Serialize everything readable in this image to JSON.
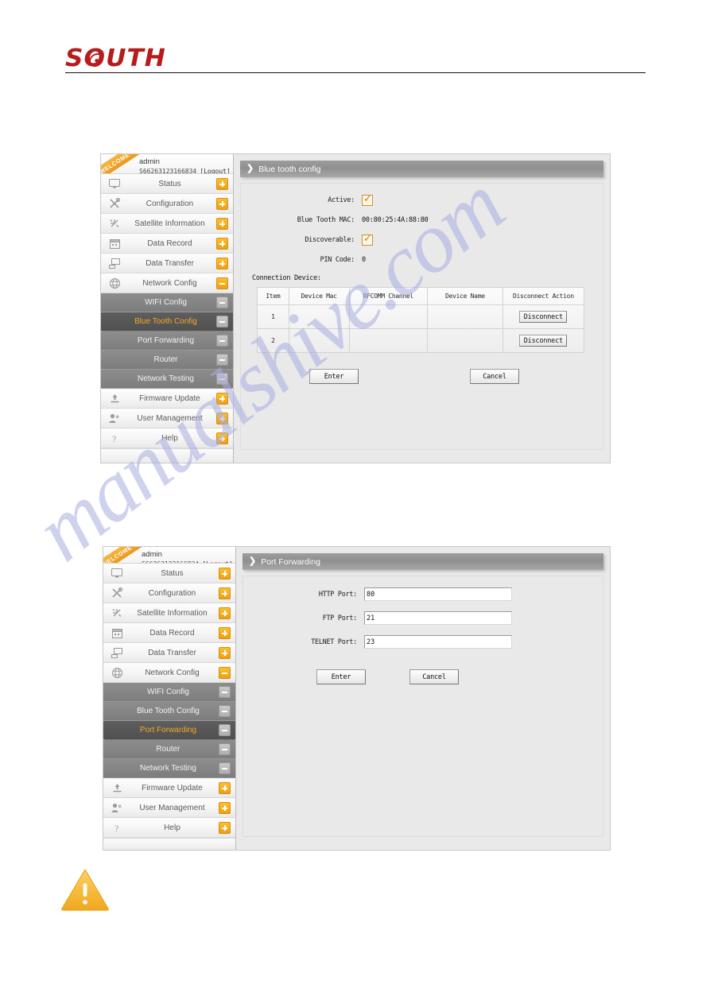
{
  "document": {
    "brand": "SOUTH",
    "watermark": "manualshive.com"
  },
  "sidebar": {
    "welcome_ribbon": "WELCOME",
    "username": "admin",
    "serial": "S66263123166834",
    "logout": "[Logout]",
    "items": [
      {
        "label": "Status",
        "icon": "monitor-icon",
        "toggle": "plus"
      },
      {
        "label": "Configuration",
        "icon": "tools-icon",
        "toggle": "plus"
      },
      {
        "label": "Satellite Information",
        "icon": "satellite-icon",
        "toggle": "plus"
      },
      {
        "label": "Data Record",
        "icon": "calendar-icon",
        "toggle": "plus"
      },
      {
        "label": "Data Transfer",
        "icon": "transfer-icon",
        "toggle": "plus"
      },
      {
        "label": "Network Config",
        "icon": "globe-icon",
        "toggle": "open"
      }
    ],
    "submenu": [
      {
        "label": "WIFI Config",
        "toggle": "minus"
      },
      {
        "label": "Blue Tooth Config",
        "toggle": "minus"
      },
      {
        "label": "Port Forwarding",
        "toggle": "minus"
      },
      {
        "label": "Router",
        "toggle": "minus"
      },
      {
        "label": "Network Testing",
        "toggle": "minus"
      }
    ],
    "items_after": [
      {
        "label": "Firmware Update",
        "icon": "upload-icon",
        "toggle": "plus"
      },
      {
        "label": "User Management",
        "icon": "users-icon",
        "toggle": "plus"
      },
      {
        "label": "Help",
        "icon": "question-icon",
        "toggle": "plus"
      }
    ]
  },
  "bluetooth": {
    "panel_title": "Blue tooth config",
    "active_label": "Active:",
    "active_checked": "✓",
    "mac_label": "Blue Tooth MAC:",
    "mac_value": "00:80:25:4A:88:80",
    "discoverable_label": "Discoverable:",
    "discoverable_checked": "✓",
    "pin_label": "PIN Code:",
    "pin_value": "0",
    "connection_label": "Connection Device:",
    "table": {
      "headers": [
        "Item",
        "Device Mac",
        "RFCOMM Channel",
        "Device Name",
        "Disconnect Action"
      ],
      "rows": [
        {
          "item": "1",
          "device_mac": "",
          "rfcomm": "",
          "device_name": "",
          "action": "Disconnect"
        },
        {
          "item": "2",
          "device_mac": "",
          "rfcomm": "",
          "device_name": "",
          "action": "Disconnect"
        }
      ]
    },
    "enter_label": "Enter",
    "cancel_label": "Cancel",
    "active_submenu": "Blue Tooth Config"
  },
  "portforward": {
    "panel_title": "Port Forwarding",
    "http_label": "HTTP Port:",
    "http_value": "80",
    "ftp_label": "FTP Port:",
    "ftp_value": "21",
    "telnet_label": "TELNET Port:",
    "telnet_value": "23",
    "enter_label": "Enter",
    "cancel_label": "Cancel",
    "active_submenu": "Port Forwarding"
  },
  "colors": {
    "brand_red": "#b61c1c",
    "accent_orange": "#f5a623",
    "toggle_orange": "#ef9f14",
    "submenu_gray": "#808080",
    "panel_header_gray": "#9d9d9d",
    "warning_yellow": "#f5b831"
  }
}
